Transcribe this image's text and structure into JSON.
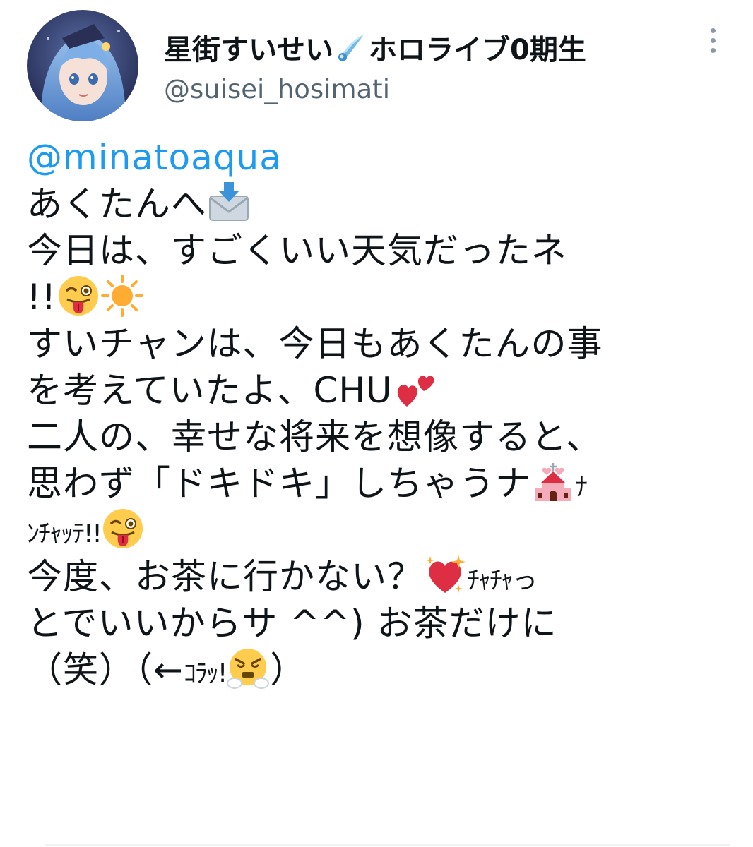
{
  "tweet": {
    "display_name_part1": "星街すいせい",
    "display_name_part2": "ホロライブ0期生",
    "handle": "@suisei_hosimati",
    "mention": "@minatoaqua",
    "lines": {
      "l1": "あくたんへ",
      "l2": "今日は、すごくいい天気だったネ",
      "l3": "!!",
      "l4": "すいチャンは、今日もあくたんの事",
      "l5": "を考えていたよ、CHU",
      "l6": "二人の、幸せな将来を想像すると、",
      "l7a": "思わず「ドキドキ」しちゃうナ",
      "l7b": "ﾅ",
      "l8a": "ﾝﾁｬｯﾃ!!",
      "l9a": "今度、お茶に行かない？",
      "l9b": "ﾁｬﾁｬっ",
      "l10": "とでいいからサ ^^) お茶だけに",
      "l11a": "（笑）（←",
      "l11b": "ｺﾗｯ!",
      "l11c": "）"
    }
  },
  "icons": {
    "comet": "comet-icon",
    "envelope": "incoming-envelope-emoji",
    "wink": "winking-face-tongue-emoji",
    "sun": "sun-emoji",
    "hearts": "two-hearts-emoji",
    "wedding": "wedding-chapel-emoji",
    "sparkle_heart": "sparkling-heart-emoji",
    "steam": "face-with-steam-emoji",
    "more": "more-options-icon"
  },
  "colors": {
    "link": "#1d9bf0",
    "text": "#0f1419",
    "secondary": "#536471"
  }
}
